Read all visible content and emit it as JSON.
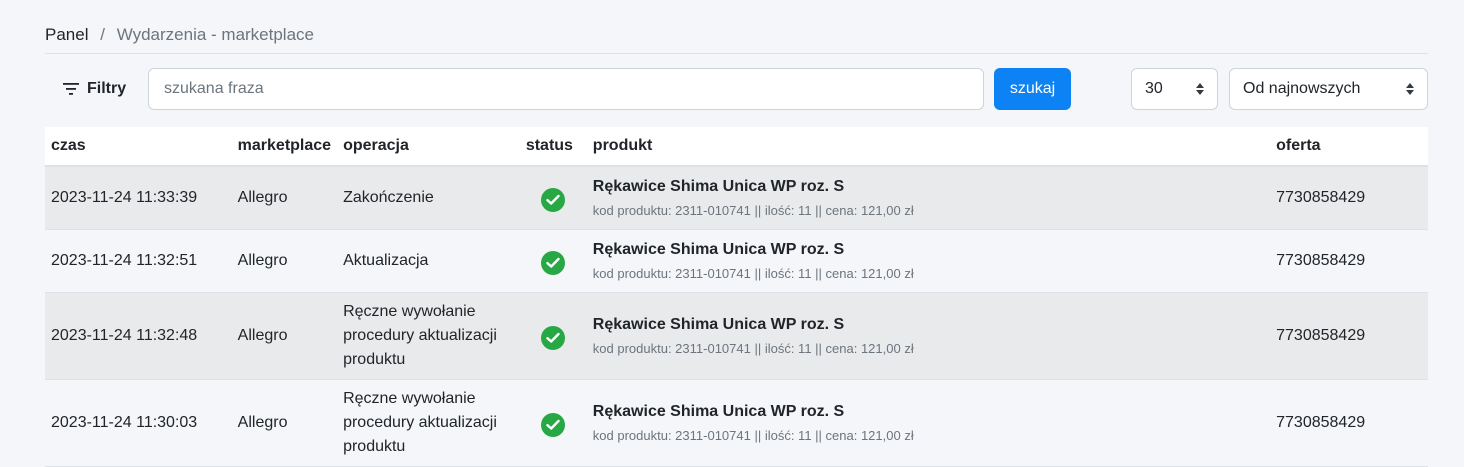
{
  "breadcrumb": {
    "home": "Panel",
    "separator": "/",
    "current": "Wydarzenia - marketplace"
  },
  "toolbar": {
    "filters_label": "Filtry",
    "search_placeholder": "szukana fraza",
    "search_value": "",
    "search_button": "szukaj",
    "limit_value": "30",
    "sort_value": "Od najnowszych"
  },
  "table": {
    "columns": [
      "czas",
      "marketplace",
      "operacja",
      "status",
      "produkt",
      "oferta"
    ],
    "rows": [
      {
        "time": "2023-11-24 11:33:39",
        "marketplace": "Allegro",
        "operation": "Zakończenie",
        "status": "success",
        "product_name": "Rękawice Shima Unica WP roz. S",
        "product_meta": "kod produktu: 2311-010741 || ilość: 11 || cena: 121,00 zł",
        "offer": "7730858429"
      },
      {
        "time": "2023-11-24 11:32:51",
        "marketplace": "Allegro",
        "operation": "Aktualizacja",
        "status": "success",
        "product_name": "Rękawice Shima Unica WP roz. S",
        "product_meta": "kod produktu: 2311-010741 || ilość: 11 || cena: 121,00 zł",
        "offer": "7730858429"
      },
      {
        "time": "2023-11-24 11:32:48",
        "marketplace": "Allegro",
        "operation": "Ręczne wywołanie procedury aktualizacji produktu",
        "status": "success",
        "product_name": "Rękawice Shima Unica WP roz. S",
        "product_meta": "kod produktu: 2311-010741 || ilość: 11 || cena: 121,00 zł",
        "offer": "7730858429"
      },
      {
        "time": "2023-11-24 11:30:03",
        "marketplace": "Allegro",
        "operation": "Ręczne wywołanie procedury aktualizacji produktu",
        "status": "success",
        "product_name": "Rękawice Shima Unica WP roz. S",
        "product_meta": "kod produktu: 2311-010741 || ilość: 11 || cena: 121,00 zł",
        "offer": "7730858429"
      }
    ]
  },
  "colors": {
    "primary": "#0d82f4",
    "success": "#28a745",
    "row_stripe": "#e9eaec",
    "background": "#f4f6f9"
  },
  "icons": {
    "filters": "filter-lines-icon",
    "status_success": "check-circle-icon",
    "select_arrows": "updown-icon"
  }
}
